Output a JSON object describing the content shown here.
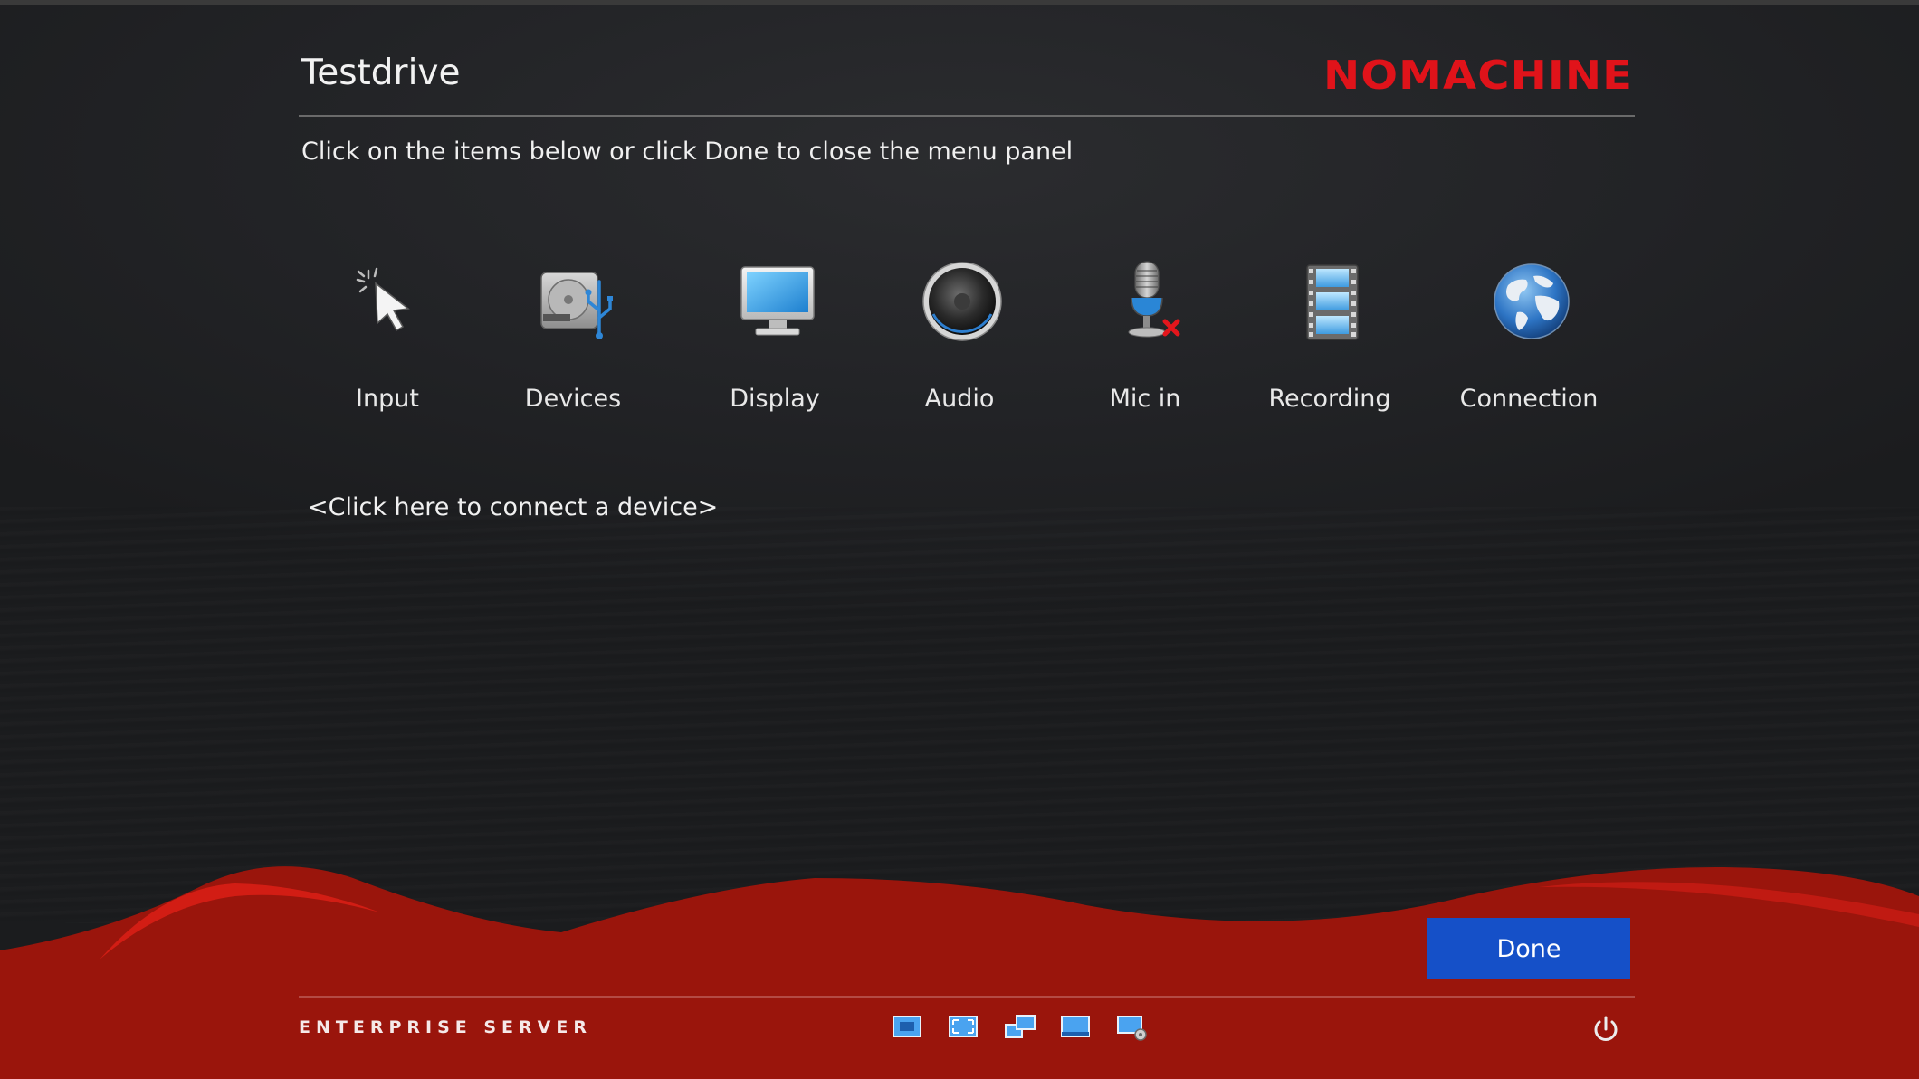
{
  "window": {
    "title": "Testdrive",
    "brand": "NOMACHINE",
    "instruction": "Click on the items below or click Done to close the menu panel"
  },
  "menu": {
    "items": [
      {
        "label": "Input",
        "icon": "cursor-icon"
      },
      {
        "label": "Devices",
        "icon": "hard-drive-usb-icon"
      },
      {
        "label": "Display",
        "icon": "monitor-icon"
      },
      {
        "label": "Audio",
        "icon": "speaker-icon"
      },
      {
        "label": "Mic in",
        "icon": "microphone-muted-icon"
      },
      {
        "label": "Recording",
        "icon": "film-strip-icon"
      },
      {
        "label": "Connection",
        "icon": "globe-icon"
      }
    ]
  },
  "devices": {
    "connect_link": "<Click here to connect a device>"
  },
  "actions": {
    "done_label": "Done"
  },
  "footer": {
    "edition": "ENTERPRISE SERVER",
    "icons": [
      "fit-to-window-icon",
      "scale-icon",
      "multi-monitor-icon",
      "single-monitor-icon",
      "display-settings-icon",
      "power-icon"
    ]
  },
  "colors": {
    "brand_red": "#e0131a",
    "wave_red": "#9a150c",
    "done_blue": "#1550c8",
    "background": "#1e1f21"
  }
}
